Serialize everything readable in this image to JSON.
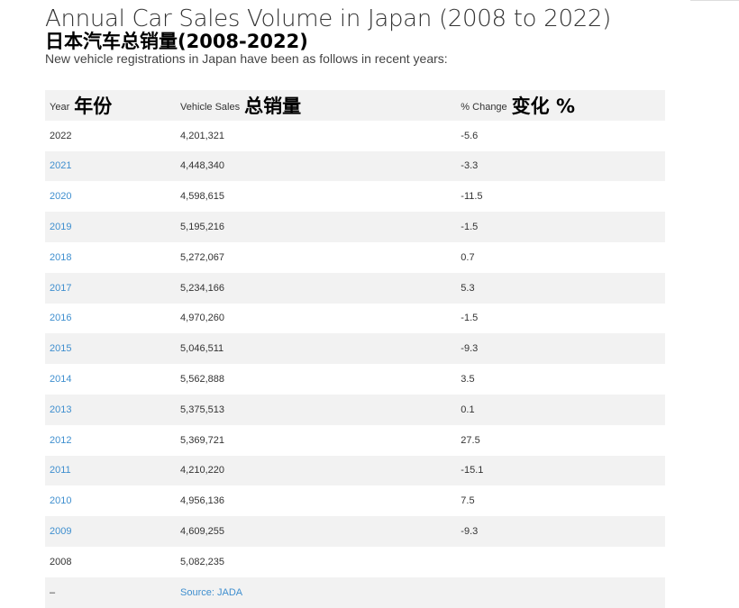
{
  "page": {
    "title": "Annual Car Sales Volume in Japan (2008 to 2022)",
    "chinese_title": "日本汽车总销量(2008-2022)",
    "subtitle": "New vehicle registrations in Japan have been as follows in recent years:"
  },
  "table": {
    "headers": [
      {
        "label": "Year",
        "chinese": "年份"
      },
      {
        "label": "Vehicle Sales",
        "chinese": "总销量"
      },
      {
        "label": "% Change",
        "chinese": "变化 %"
      }
    ],
    "rows": [
      {
        "year": "2022",
        "sales": "4,201,321",
        "change": "-5.6",
        "linked": false
      },
      {
        "year": "2021",
        "sales": "4,448,340",
        "change": "-3.3",
        "linked": true
      },
      {
        "year": "2020",
        "sales": "4,598,615",
        "change": "-11.5",
        "linked": true
      },
      {
        "year": "2019",
        "sales": "5,195,216",
        "change": "-1.5",
        "linked": true
      },
      {
        "year": "2018",
        "sales": "5,272,067",
        "change": "0.7",
        "linked": true
      },
      {
        "year": "2017",
        "sales": "5,234,166",
        "change": "5.3",
        "linked": true
      },
      {
        "year": "2016",
        "sales": "4,970,260",
        "change": "-1.5",
        "linked": true
      },
      {
        "year": "2015",
        "sales": "5,046,511",
        "change": "-9.3",
        "linked": true
      },
      {
        "year": "2014",
        "sales": "5,562,888",
        "change": "3.5",
        "linked": true
      },
      {
        "year": "2013",
        "sales": "5,375,513",
        "change": "0.1",
        "linked": true
      },
      {
        "year": "2012",
        "sales": "5,369,721",
        "change": "27.5",
        "linked": true
      },
      {
        "year": "2011",
        "sales": "4,210,220",
        "change": "-15.1",
        "linked": true
      },
      {
        "year": "2010",
        "sales": "4,956,136",
        "change": "7.5",
        "linked": true
      },
      {
        "year": "2009",
        "sales": "4,609,255",
        "change": "-9.3",
        "linked": true
      },
      {
        "year": "2008",
        "sales": "5,082,235",
        "change": "",
        "linked": false
      }
    ],
    "footer": {
      "dash": "–",
      "source": "Source: JADA"
    }
  },
  "colors": {
    "link": "#3f8fcf",
    "stripe": "#f2f2f2",
    "text": "#333333"
  }
}
